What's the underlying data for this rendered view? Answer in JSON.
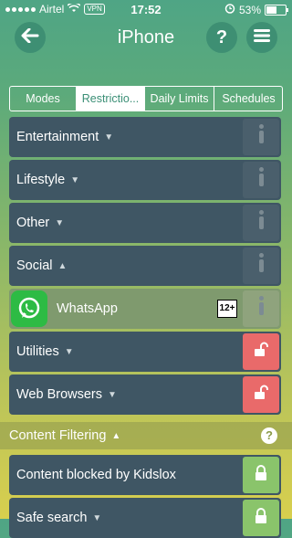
{
  "status_bar": {
    "carrier": "Airtel",
    "vpn": "VPN",
    "time": "17:52",
    "battery": "53%"
  },
  "header": {
    "title": "iPhone",
    "help_label": "?"
  },
  "tabs": [
    {
      "label": "Modes",
      "active": false
    },
    {
      "label": "Restrictio...",
      "active": true
    },
    {
      "label": "Daily Limits",
      "active": false
    },
    {
      "label": "Schedules",
      "active": false
    }
  ],
  "categories": [
    {
      "label": "Entertainment"
    },
    {
      "label": "Lifestyle"
    },
    {
      "label": "Other"
    },
    {
      "label": "Social"
    },
    {
      "label": "Utilities"
    },
    {
      "label": "Web Browsers"
    }
  ],
  "whatsapp": {
    "label": "WhatsApp",
    "age_rating": "12+"
  },
  "content_filtering": {
    "title": "Content Filtering",
    "help_label": "?",
    "items": [
      {
        "label": "Content blocked by Kidslox"
      },
      {
        "label": "Safe search"
      }
    ]
  },
  "colors": {
    "row_bg": "#3f5664",
    "unlocked_red": "#e96a6a",
    "locked_green": "#8ac46b",
    "whatsapp_green": "#2dbb44"
  },
  "icons": {
    "back": "arrow-left-icon",
    "help": "question-icon",
    "menu": "hamburger-icon",
    "info": "info-icon",
    "unlock": "unlock-icon",
    "lock": "lock-icon"
  }
}
